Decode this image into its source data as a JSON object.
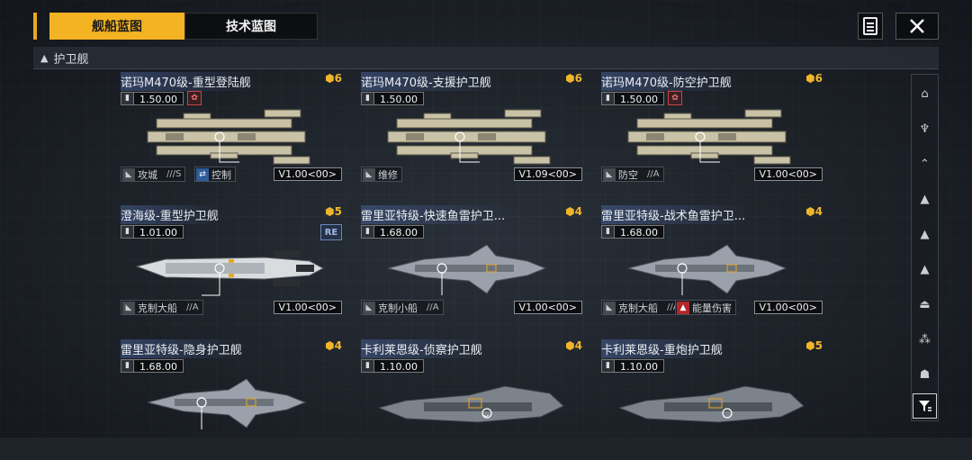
{
  "tabs": [
    {
      "label": "舰船蓝图",
      "active": true
    },
    {
      "label": "技术蓝图",
      "active": false
    }
  ],
  "toolbar": {
    "notes_icon": "notes-icon",
    "close_icon": "close-icon"
  },
  "section": {
    "title": "护卫舰"
  },
  "colors": {
    "accent": "#f4b323",
    "cost": "#f0b52a",
    "bg": "#1f242b"
  },
  "cards": [
    {
      "title": "诺玛M470级-重型登陆舰",
      "cost": "6",
      "command": "1.50.00",
      "has_module": true,
      "role": "攻城",
      "grade": "///S",
      "trait": "控制",
      "trait_icon": "swap-icon",
      "version": "V1.00<00>",
      "ship_kind": "heavy"
    },
    {
      "title": "诺玛M470级-支援护卫舰",
      "cost": "6",
      "command": "1.50.00",
      "has_module": false,
      "role": "维修",
      "grade": "",
      "trait": "",
      "trait_icon": "",
      "version": "V1.09<00>",
      "ship_kind": "heavy"
    },
    {
      "title": "诺玛M470级-防空护卫舰",
      "cost": "6",
      "command": "1.50.00",
      "has_module": true,
      "role": "防空",
      "grade": "//A",
      "trait": "",
      "trait_icon": "",
      "version": "V1.00<00>",
      "ship_kind": "heavy"
    },
    {
      "title": "澄海级-重型护卫舰",
      "cost": "5",
      "command": "1.01.00",
      "has_module": false,
      "re_badge": "RE",
      "role": "克制大船",
      "grade": "//A",
      "trait": "",
      "trait_icon": "",
      "version": "V1.00<00>",
      "ship_kind": "white"
    },
    {
      "title": "雷里亚特级-快速鱼雷护卫...",
      "cost": "4",
      "command": "1.68.00",
      "has_module": false,
      "role": "克制小船",
      "grade": "//A",
      "trait": "",
      "trait_icon": "",
      "version": "V1.00<00>",
      "ship_kind": "grey"
    },
    {
      "title": "雷里亚特级-战术鱼雷护卫...",
      "cost": "4",
      "command": "1.68.00",
      "has_module": false,
      "role": "克制大船",
      "grade": "//A",
      "trait": "能量伤害",
      "trait_icon": "energy-icon",
      "version": "V1.00<00>",
      "ship_kind": "grey"
    },
    {
      "title": "雷里亚特级-隐身护卫舰",
      "cost": "4",
      "command": "1.68.00",
      "has_module": false,
      "role": "",
      "grade": "",
      "trait": "",
      "trait_icon": "",
      "version": "",
      "ship_kind": "grey"
    },
    {
      "title": "卡利莱恩级-侦察护卫舰",
      "cost": "4",
      "command": "1.10.00",
      "has_module": false,
      "role": "",
      "grade": "",
      "trait": "",
      "trait_icon": "",
      "version": "",
      "ship_kind": "dark"
    },
    {
      "title": "卡利莱恩级-重炮护卫舰",
      "cost": "5",
      "command": "1.10.00",
      "has_module": false,
      "role": "",
      "grade": "",
      "trait": "",
      "trait_icon": "",
      "version": "",
      "ship_kind": "dark"
    }
  ],
  "sidebar_filters": [
    "class-1-icon",
    "class-2-icon",
    "class-3-icon",
    "class-4-icon",
    "class-5-icon",
    "class-6-icon",
    "class-7-icon",
    "class-8-icon",
    "class-9-icon"
  ],
  "sidebar_funnel": "filter-funnel-icon"
}
